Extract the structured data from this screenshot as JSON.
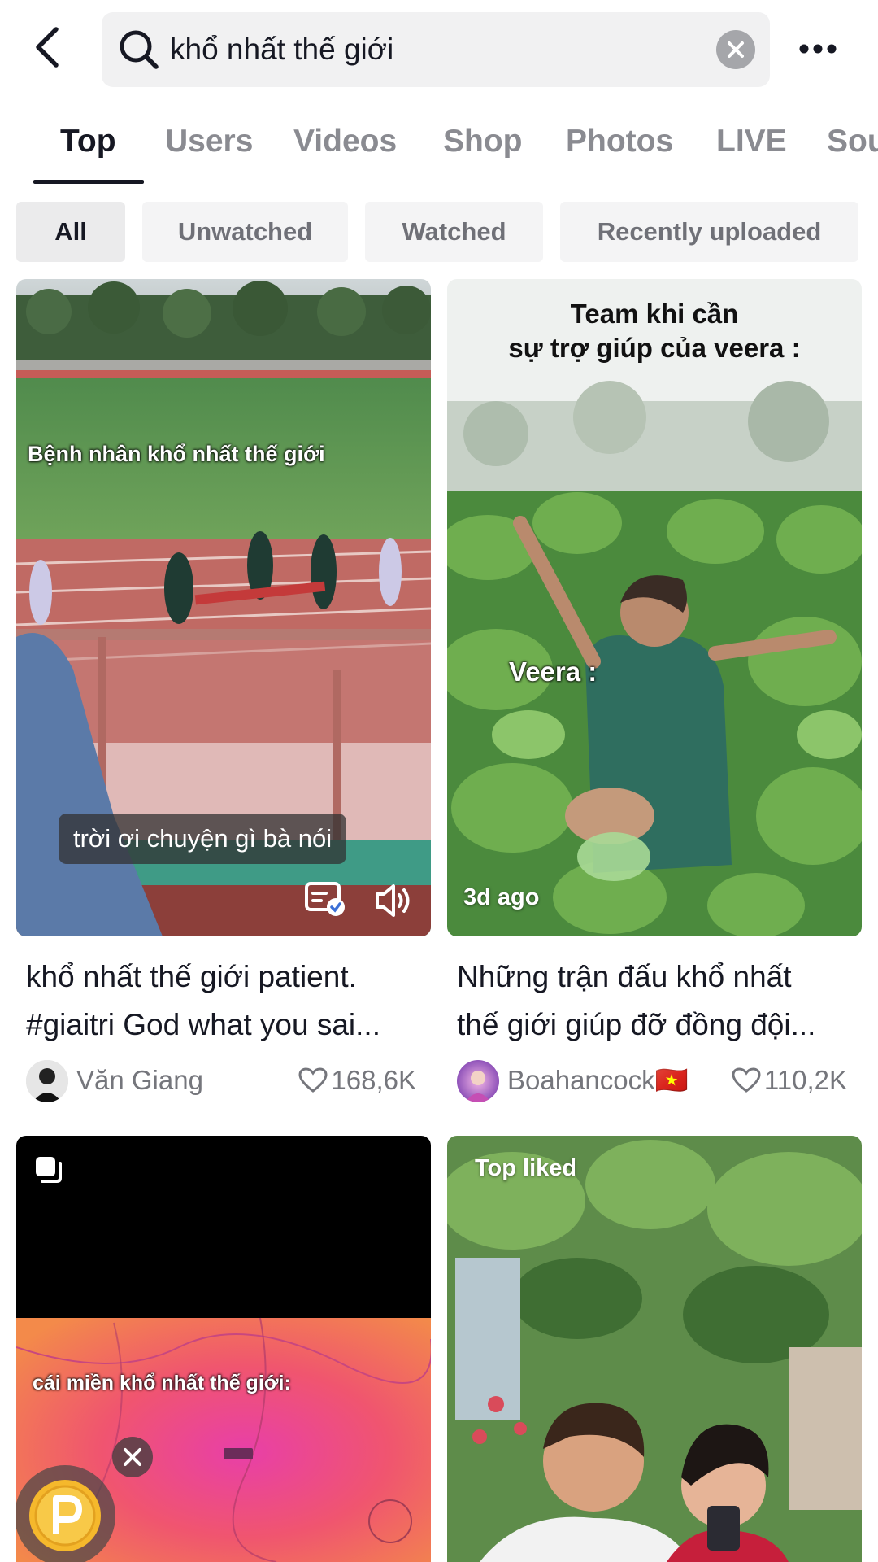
{
  "search": {
    "query": "khổ nhất thế giới"
  },
  "tabs": [
    {
      "label": "Top",
      "active": true
    },
    {
      "label": "Users"
    },
    {
      "label": "Videos"
    },
    {
      "label": "Shop"
    },
    {
      "label": "Photos"
    },
    {
      "label": "LIVE"
    },
    {
      "label": "Sou"
    }
  ],
  "filters": [
    {
      "label": "All",
      "active": true
    },
    {
      "label": "Unwatched"
    },
    {
      "label": "Watched"
    },
    {
      "label": "Recently uploaded"
    }
  ],
  "results": [
    {
      "overlay_text": "Bệnh nhân khổ nhất thế giới",
      "caption": "trời ơi chuyện gì bà nói",
      "title_line1": "khổ nhất thế giới patient.",
      "title_line2": "#giaitri God what you sai...",
      "author": "Văn Giang",
      "likes": "168,6K",
      "icons": [
        "captions-icon",
        "speaker-icon"
      ]
    },
    {
      "overlay_title_line1": "Team khi cần",
      "overlay_title_line2": "sự trợ giúp của veera :",
      "overlay_label": "Veera :",
      "badge": "3d ago",
      "title_line1": "Những trận đấu khổ nhất",
      "title_line2": "thế giới giúp đỡ đồng đội...",
      "author": "Boahancock🇻🇳",
      "likes": "110,2K"
    },
    {
      "overlay_text": "cái miền khổ nhất thế giới:",
      "icons": [
        "photo-carousel-icon",
        "points-coin-icon",
        "close-icon"
      ]
    },
    {
      "badge": "Top liked"
    }
  ],
  "colors": {
    "text_primary": "#161823",
    "text_secondary": "#75767c",
    "chip_bg": "#f4f4f5"
  }
}
